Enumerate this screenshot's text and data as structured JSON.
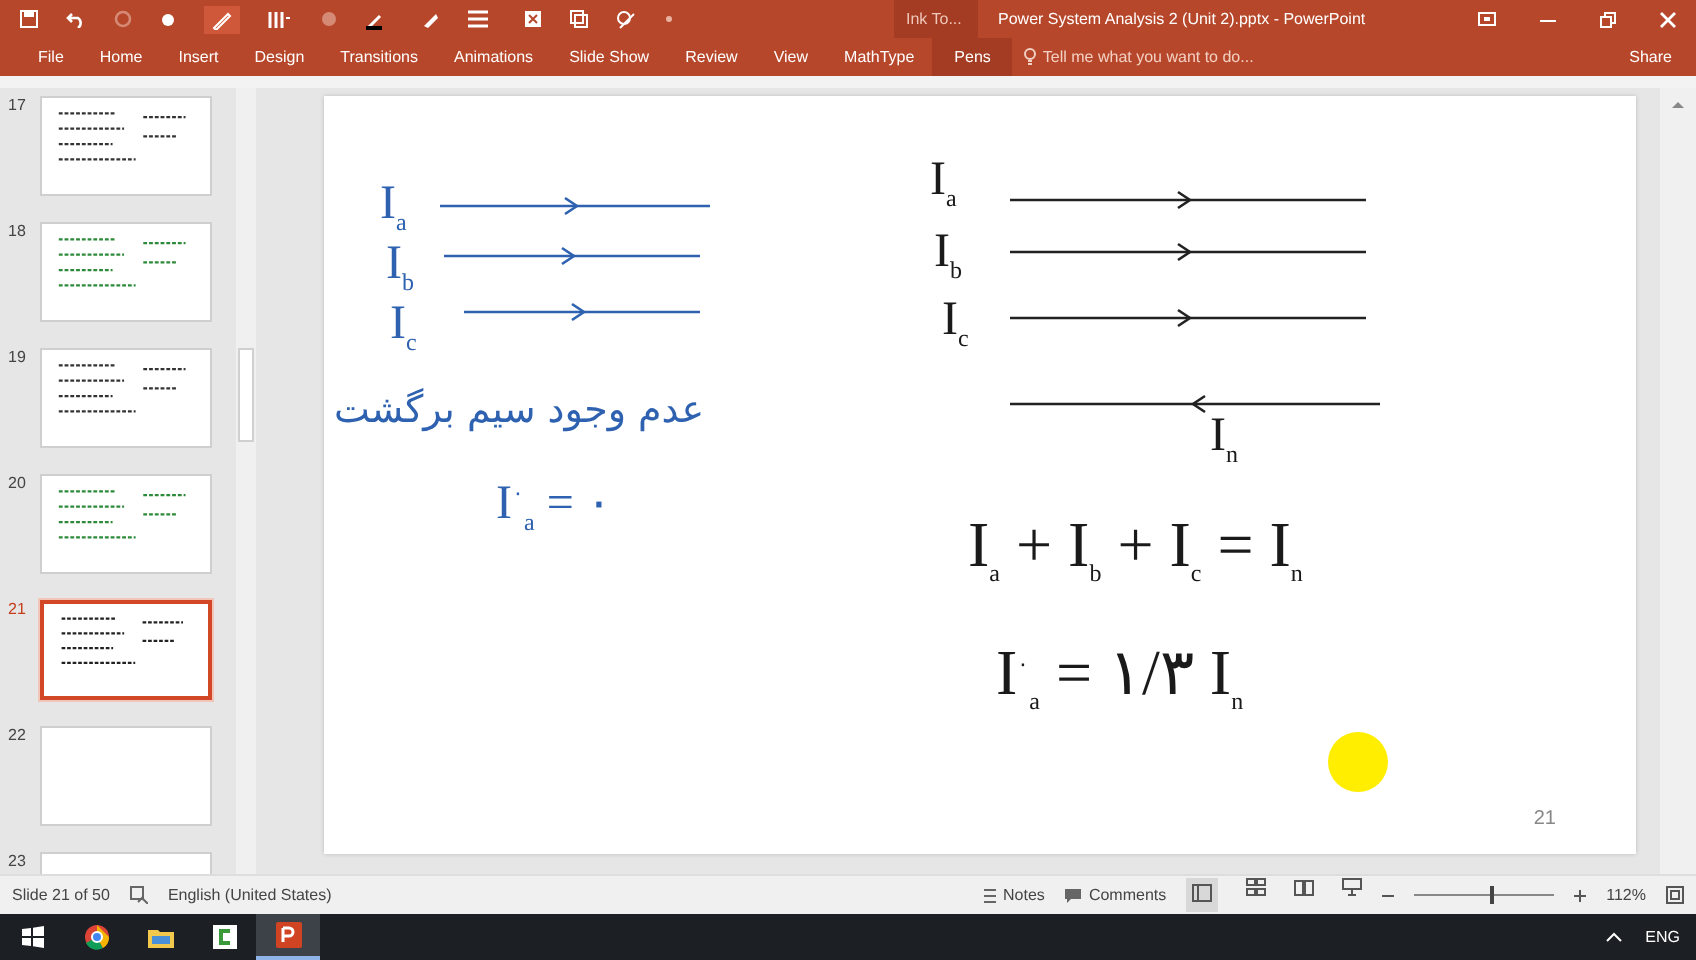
{
  "window": {
    "title": "Power System Analysis 2 (Unit 2).pptx - PowerPoint",
    "context_group": "Ink To..."
  },
  "ribbon_tabs": [
    {
      "label": "File",
      "selected": false
    },
    {
      "label": "Home",
      "selected": false
    },
    {
      "label": "Insert",
      "selected": false
    },
    {
      "label": "Design",
      "selected": false
    },
    {
      "label": "Transitions",
      "selected": false
    },
    {
      "label": "Animations",
      "selected": false
    },
    {
      "label": "Slide Show",
      "selected": false
    },
    {
      "label": "Review",
      "selected": false
    },
    {
      "label": "View",
      "selected": false
    },
    {
      "label": "MathType",
      "selected": false
    },
    {
      "label": "Pens",
      "selected": true
    }
  ],
  "tell_me": {
    "placeholder": "Tell me what you want to do..."
  },
  "share_button": "Share",
  "thumbnails": [
    {
      "number": "17",
      "kind": "ink",
      "selected": false
    },
    {
      "number": "18",
      "kind": "ink",
      "selected": false
    },
    {
      "number": "19",
      "kind": "ink",
      "selected": false
    },
    {
      "number": "20",
      "kind": "ink",
      "selected": false
    },
    {
      "number": "21",
      "kind": "ink",
      "selected": true
    },
    {
      "number": "22",
      "kind": "blank",
      "selected": false
    },
    {
      "number": "23",
      "kind": "blank",
      "selected": false
    }
  ],
  "slide": {
    "left": {
      "currents": [
        "I$_{a}$",
        "I$_{b}$",
        "I$_{c}$"
      ],
      "note": "عدم وجود سیم برگشت",
      "equation": "I$^{۰}$$_{a}$ = ۰"
    },
    "right": {
      "currents": [
        "I$_{a}$",
        "I$_{b}$",
        "I$_{c}$"
      ],
      "neutral": "I$_{n}$",
      "equations": [
        "I$_{a}$ + I$_{b}$ + I$_{c}$ = I$_{n}$",
        "I$^{۰}$$_{a}$ = ۱/۳ I$_{n}$"
      ]
    },
    "page_number": "21"
  },
  "status_bar": {
    "slide_info": "Slide 21 of 50",
    "language": "English (United States)",
    "notes": "Notes",
    "comments": "Comments",
    "zoom_slider": {
      "level": 0.54
    },
    "zoom": "112%"
  },
  "taskbar": {
    "apps": [
      {
        "kind": "chrome",
        "selected": false
      },
      {
        "kind": "explorer",
        "selected": false
      },
      {
        "kind": "camtasia",
        "selected": false
      },
      {
        "kind": "powerpoint",
        "selected": true
      }
    ],
    "language": "ENG"
  }
}
